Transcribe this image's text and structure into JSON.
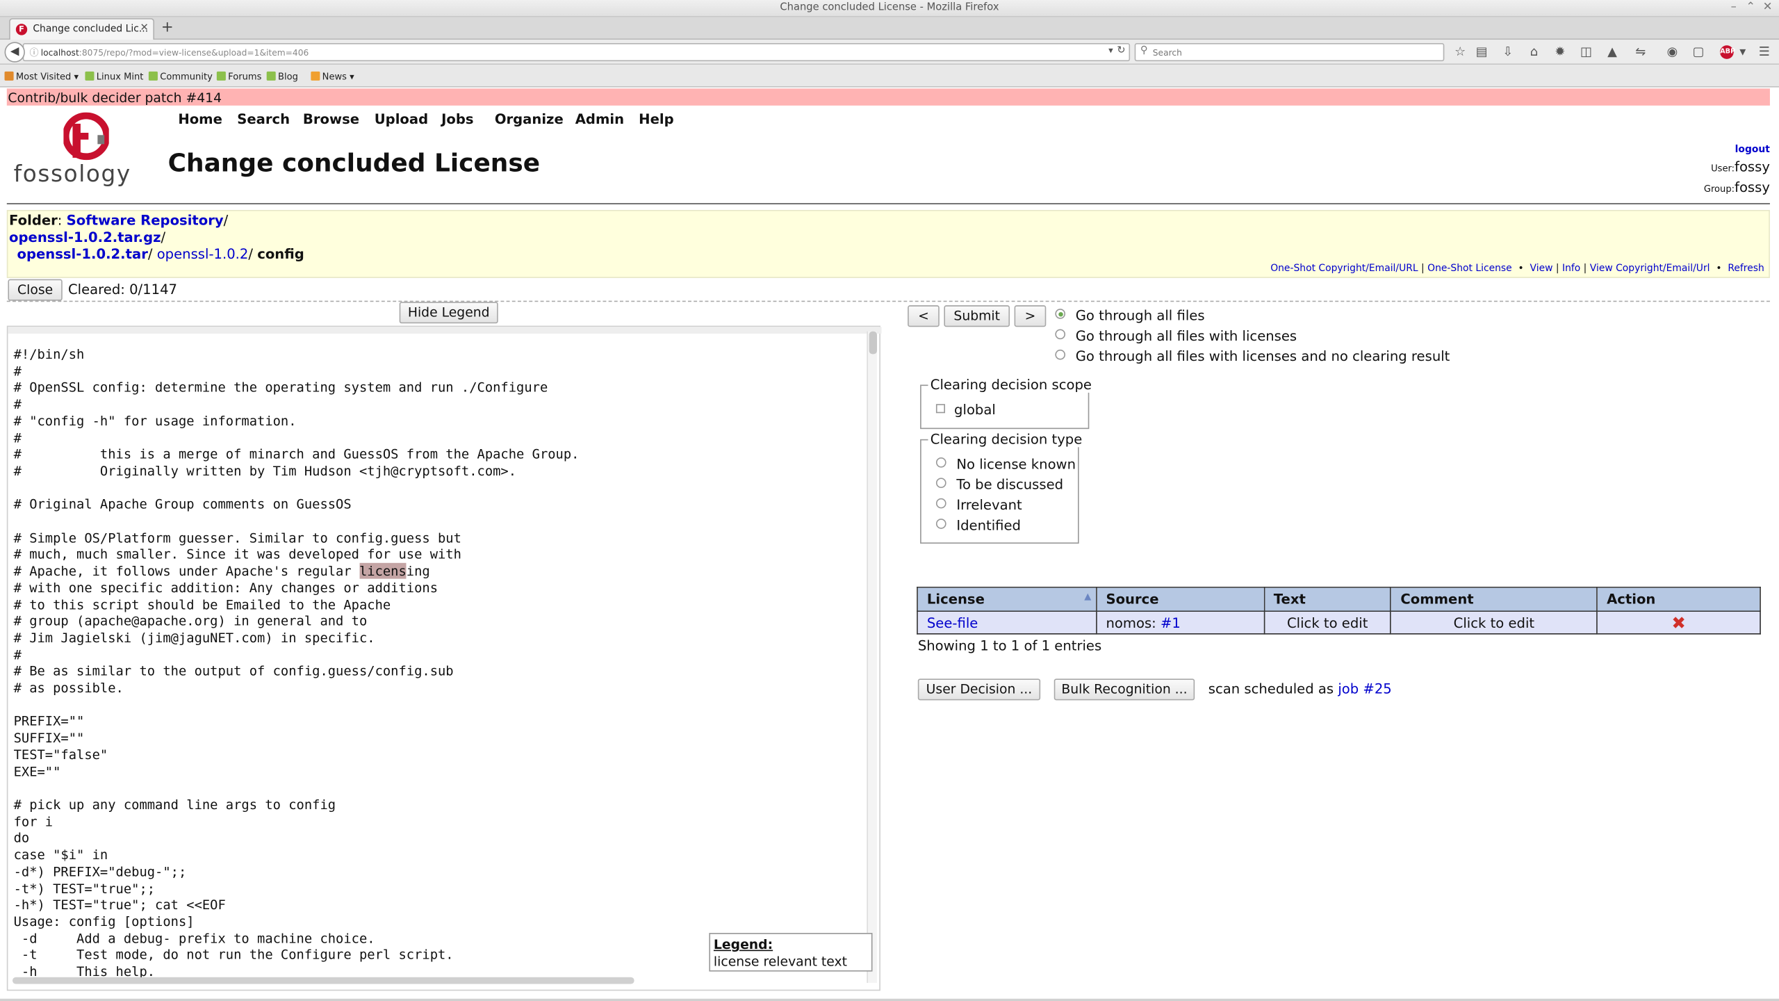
{
  "window": {
    "title": "Change concluded License - Mozilla Firefox",
    "tab_title": "Change concluded Lic...",
    "url_host": "localhost",
    "url_rest": ":8075/repo/?mod=view-license&upload=1&item=406",
    "search_placeholder": "Search"
  },
  "bookmarks": [
    {
      "label": "Most Visited ▾",
      "color": "#e08a2c"
    },
    {
      "label": "Linux Mint",
      "color": "#8cc04b"
    },
    {
      "label": "Community",
      "color": "#8cc04b"
    },
    {
      "label": "Forums",
      "color": "#8cc04b"
    },
    {
      "label": "Blog",
      "color": "#8cc04b"
    },
    {
      "label": "News ▾",
      "color": "#f0a030"
    }
  ],
  "banner": "Contrib/bulk decider patch #414",
  "logo": {
    "mark": "F",
    "text": "fossology"
  },
  "menu": [
    "Home",
    "Search",
    "Browse",
    "Upload",
    "Jobs",
    "Organize",
    "Admin",
    "Help"
  ],
  "page_title": "Change concluded License",
  "user": {
    "logout": "logout",
    "user_label": "User:",
    "user_name": "fossy",
    "group_label": "Group:",
    "group_name": "fossy"
  },
  "folder": {
    "label": "Folder",
    "root": "Software Repository",
    "archive": "openssl-1.0.2.tar.gz",
    "tar": "openssl-1.0.2.tar",
    "dir": "openssl-1.0.2",
    "file": "config"
  },
  "links": [
    "One-Shot Copyright/Email/URL",
    "One-Shot License",
    "View",
    "Info",
    "View Copyright/Email/Url",
    "Refresh"
  ],
  "close_label": "Close",
  "cleared_text": "Cleared: 0/1147",
  "hide_legend_label": "Hide Legend",
  "code": {
    "before": "#!/bin/sh\n#\n# OpenSSL config: determine the operating system and run ./Configure\n#\n# \"config -h\" for usage information.\n#\n#          this is a merge of minarch and GuessOS from the Apache Group.\n#          Originally written by Tim Hudson <tjh@cryptsoft.com>.\n\n# Original Apache Group comments on GuessOS\n\n# Simple OS/Platform guesser. Similar to config.guess but\n# much, much smaller. Since it was developed for use with\n# Apache, it follows under Apache's regular ",
    "highlight": "licens",
    "after": "ing\n# with one specific addition: Any changes or additions\n# to this script should be Emailed to the Apache\n# group (apache@apache.org) in general and to\n# Jim Jagielski (jim@jaguNET.com) in specific.\n#\n# Be as similar to the output of config.guess/config.sub\n# as possible.\n\nPREFIX=\"\"\nSUFFIX=\"\"\nTEST=\"false\"\nEXE=\"\"\n\n# pick up any command line args to config\nfor i\ndo\ncase \"$i\" in\n-d*) PREFIX=\"debug-\";;\n-t*) TEST=\"true\";;\n-h*) TEST=\"true\"; cat <<EOF\nUsage: config [options]\n -d     Add a debug- prefix to machine choice.\n -t     Test mode, do not run the Configure perl script.\n -h     This help."
  },
  "legend": {
    "title": "Legend:",
    "item": "license relevant text"
  },
  "nav": {
    "prev": "<",
    "submit": "Submit",
    "next": ">"
  },
  "navigation_options": [
    "Go through all files",
    "Go through all files with licenses",
    "Go through all files with licenses and no clearing result"
  ],
  "scope": {
    "legend": "Clearing decision scope",
    "option": "global"
  },
  "decision_type": {
    "legend": "Clearing decision type",
    "options": [
      "No license known",
      "To be discussed",
      "Irrelevant",
      "Identified"
    ]
  },
  "table": {
    "headers": [
      "License",
      "Source",
      "Text",
      "Comment",
      "Action"
    ],
    "row": {
      "license": "See-file",
      "source_prefix": "nomos: ",
      "source_link": "#1",
      "text": "Click to edit",
      "comment": "Click to edit"
    },
    "showing": "Showing 1 to 1 of 1 entries"
  },
  "buttons": {
    "user_decision": "User Decision ...",
    "bulk_recognition": "Bulk Recognition ..."
  },
  "scan": {
    "text": "scan scheduled as ",
    "link": "job #25"
  }
}
